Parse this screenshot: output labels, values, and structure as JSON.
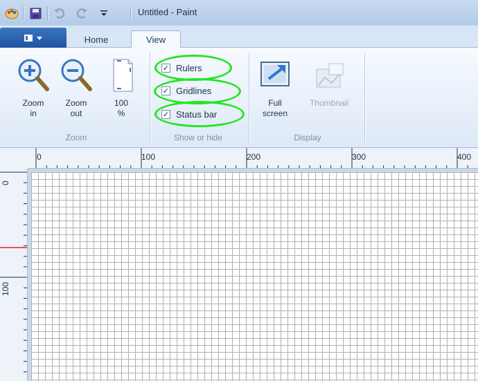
{
  "window": {
    "title": "Untitled - Paint"
  },
  "tabs": [
    {
      "label": "Home",
      "active": false
    },
    {
      "label": "View",
      "active": true
    }
  ],
  "zoom_group": {
    "label": "Zoom",
    "zoom_in": "Zoom\nin",
    "zoom_out": "Zoom\nout",
    "zoom_100": "100\n%"
  },
  "show_hide_group": {
    "label": "Show or hide",
    "rulers": {
      "label": "Rulers",
      "checked": true
    },
    "gridlines": {
      "label": "Gridlines",
      "checked": true
    },
    "status_bar": {
      "label": "Status bar",
      "checked": true
    },
    "check_mark": "✓"
  },
  "display_group": {
    "label": "Display",
    "full_screen": "Full\nscreen",
    "thumbnail": "Thumbnail"
  },
  "horizontal_ruler": {
    "labels": [
      "0",
      "100",
      "200",
      "300",
      "400"
    ]
  },
  "vertical_ruler": {
    "labels": [
      "0",
      "100"
    ]
  },
  "colors": {
    "highlight": "#22e622",
    "accent": "#1f55a0",
    "ruler_marker": "#e02020"
  }
}
